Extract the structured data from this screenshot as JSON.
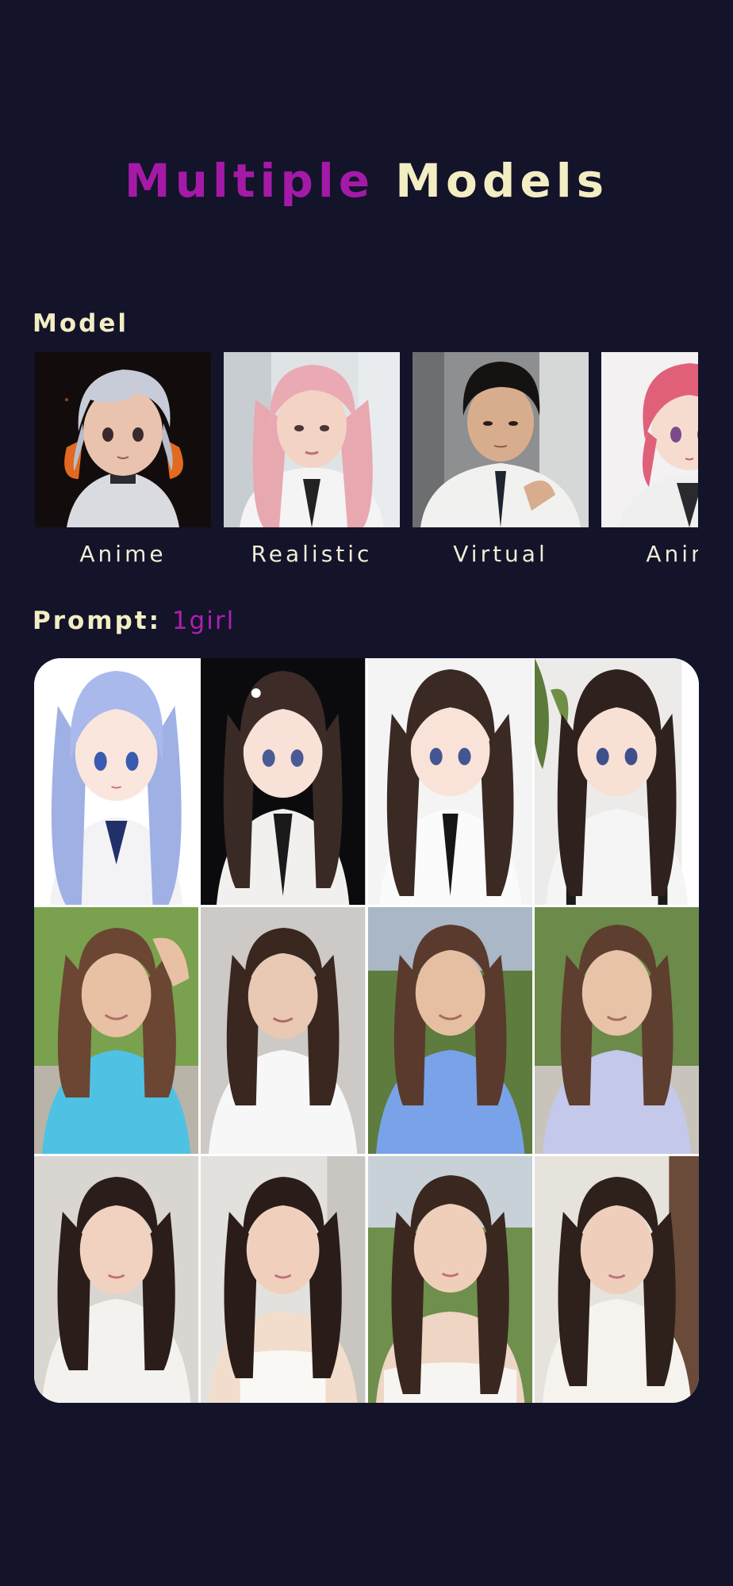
{
  "headline": {
    "accent": "Multiple",
    "rest": "Models"
  },
  "model_section": {
    "label": "Model",
    "models": [
      {
        "name": "Anime",
        "icon": "anime-portrait-dark"
      },
      {
        "name": "Realistic",
        "icon": "realistic-portrait-pink-hair"
      },
      {
        "name": "Virtual",
        "icon": "virtual-portrait-man"
      },
      {
        "name": "Anime",
        "icon": "anime-portrait-pink-hair"
      }
    ]
  },
  "prompt_section": {
    "label": "Prompt:",
    "value": "1girl"
  },
  "grid": {
    "rows": [
      {
        "style": "anime",
        "cells": [
          "anime-girl-blue-hair",
          "anime-girl-black-bg",
          "anime-girl-tie",
          "anime-girl-plant"
        ]
      },
      {
        "style": "realistic",
        "cells": [
          "woman-cyan-shirt",
          "woman-white-shirt",
          "woman-blue-shirt",
          "woman-lavender-shirt"
        ]
      },
      {
        "style": "virtual",
        "cells": [
          "girl-white-tee",
          "girl-camisole",
          "girl-offshoulder",
          "girl-cream-tee"
        ]
      }
    ]
  },
  "colors": {
    "background": "#13132a",
    "accent": "#a41aa7",
    "cream": "#f3edc3",
    "prompt_value": "#b01fb0"
  }
}
